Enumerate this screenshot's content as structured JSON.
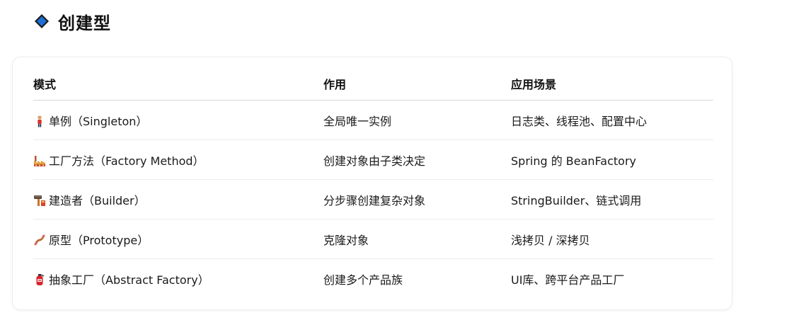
{
  "section": {
    "icon": "blue-diamond-icon",
    "title": "创建型",
    "accent": "#1e6fd6"
  },
  "table": {
    "headers": [
      "模式",
      "作用",
      "应用场景"
    ],
    "rows": [
      {
        "icon": "person-icon",
        "pattern": "单例（Singleton）",
        "purpose": "全局唯一实例",
        "scenario": "日志类、线程池、配置中心"
      },
      {
        "icon": "factory-icon",
        "pattern": "工厂方法（Factory Method）",
        "purpose": "创建对象由子类决定",
        "scenario": "Spring 的 BeanFactory"
      },
      {
        "icon": "hammer-icon",
        "pattern": "建造者（Builder）",
        "purpose": "分步骤创建复杂对象",
        "scenario": "StringBuilder、链式调用"
      },
      {
        "icon": "dna-icon",
        "pattern": "原型（Prototype）",
        "purpose": "克隆对象",
        "scenario": "浅拷贝 / 深拷贝"
      },
      {
        "icon": "fire-extinguisher-icon",
        "pattern": "抽象工厂（Abstract Factory）",
        "purpose": "创建多个产品族",
        "scenario": "UI库、跨平台产品工厂"
      }
    ]
  }
}
